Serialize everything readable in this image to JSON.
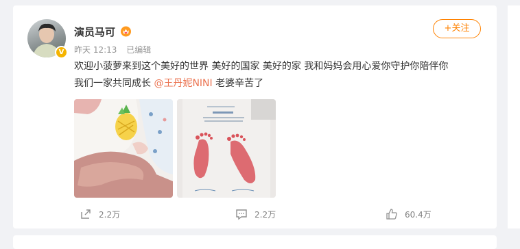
{
  "post": {
    "author": {
      "name": "演员马可",
      "verified_icon": "verified-badge-icon",
      "badge_icon": "crown-heart-icon"
    },
    "meta": {
      "time": "昨天 12:13",
      "edited": "已编辑"
    },
    "follow_label": "+关注",
    "text_line1": "欢迎小菠萝来到这个美好的世界 美好的国家 美好的家 我和妈妈会用心爱你守护你陪伴你",
    "text_line2_prefix": "我们一家共同成长 ",
    "mention": "@王丹妮NINI",
    "text_line2_suffix": " 老婆辛苦了",
    "photos": [
      {
        "description_icon": "baby-hand-photo"
      },
      {
        "description_icon": "footprint-photo"
      }
    ],
    "actions": {
      "repost_count": "2.2万",
      "comment_count": "2.2万",
      "like_count": "60.4万"
    }
  },
  "colors": {
    "accent": "#ff8200",
    "mention": "#eb7350",
    "background": "#f1f2f5"
  }
}
